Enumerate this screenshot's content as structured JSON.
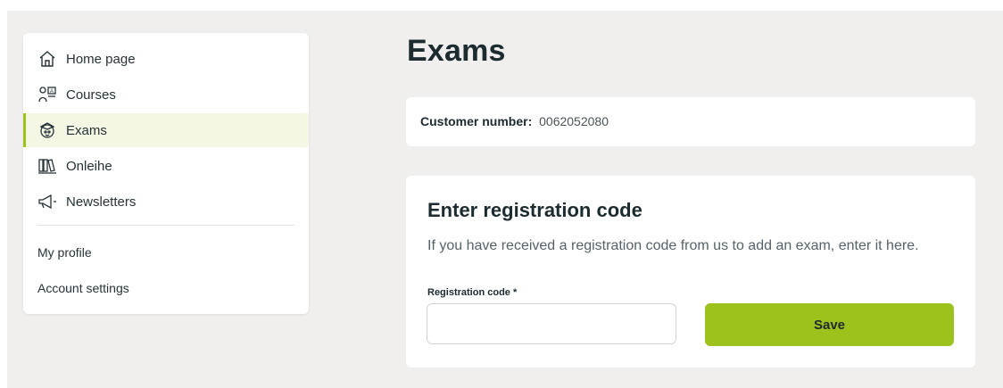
{
  "sidebar": {
    "items": [
      {
        "label": "Home page",
        "icon": "home-icon"
      },
      {
        "label": "Courses",
        "icon": "courses-icon"
      },
      {
        "label": "Exams",
        "icon": "exams-icon",
        "active": true
      },
      {
        "label": "Onleihe",
        "icon": "library-icon"
      },
      {
        "label": "Newsletters",
        "icon": "megaphone-icon"
      }
    ],
    "links": {
      "profile": "My profile",
      "settings": "Account settings"
    }
  },
  "main": {
    "title": "Exams",
    "customer": {
      "label": "Customer number:",
      "value": "0062052080"
    },
    "registration": {
      "title": "Enter registration code",
      "description": "If you have received a registration code from us to add an exam, enter it here.",
      "field_label": "Registration code *",
      "value": "",
      "save_label": "Save"
    }
  },
  "colors": {
    "accent": "#9dc21b",
    "active_bg": "#f3f7e3",
    "page_bg": "#f0efee"
  }
}
